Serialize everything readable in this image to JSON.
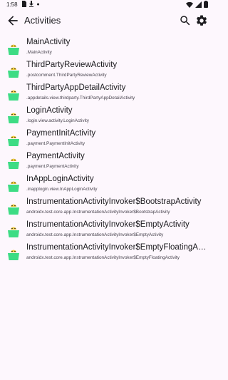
{
  "status_bar": {
    "time": "1:58",
    "left_icons": [
      "sim-card-icon",
      "download-icon",
      "dot-icon"
    ],
    "right_icons": [
      "wifi-icon",
      "signal-icon",
      "battery-icon"
    ]
  },
  "app_bar": {
    "title": "Activities",
    "back_icon": "arrow-back-icon",
    "search_icon": "search-icon",
    "settings_icon": "gear-icon"
  },
  "colors": {
    "background": "#fdf7fd",
    "android_green": "#3ddc84",
    "android_yellow": "#f4d03f",
    "text_primary": "#1c1b1f",
    "text_secondary": "#49454f"
  },
  "activities": [
    {
      "name": "MainActivity",
      "package": ".MainActivity"
    },
    {
      "name": "ThirdPartyReviewActivity",
      "package": ".postcomment.ThirdPartyReviewActivity"
    },
    {
      "name": "ThirdPartyAppDetailActivity",
      "package": ".appdetails.view.thirdparty.ThirdPartyAppDetailActivity"
    },
    {
      "name": "LoginActivity",
      "package": ".login.view.activity.LoginActivity"
    },
    {
      "name": "PaymentInitActivity",
      "package": ".payment.PaymentInitActivity"
    },
    {
      "name": "PaymentActivity",
      "package": ".payment.PaymentActivity"
    },
    {
      "name": "InAppLoginActivity",
      "package": ".inapplogin.view.InAppLoginActivity"
    },
    {
      "name": "InstrumentationActivityInvoker$BootstrapActivity",
      "package": "androidx.test.core.app.InstrumentationActivityInvoker$BootstrapActivity"
    },
    {
      "name": "InstrumentationActivityInvoker$EmptyActivity",
      "package": "androidx.test.core.app.InstrumentationActivityInvoker$EmptyActivity"
    },
    {
      "name": "InstrumentationActivityInvoker$EmptyFloatingActivity",
      "package": "androidx.test.core.app.InstrumentationActivityInvoker$EmptyFloatingActivity"
    }
  ]
}
